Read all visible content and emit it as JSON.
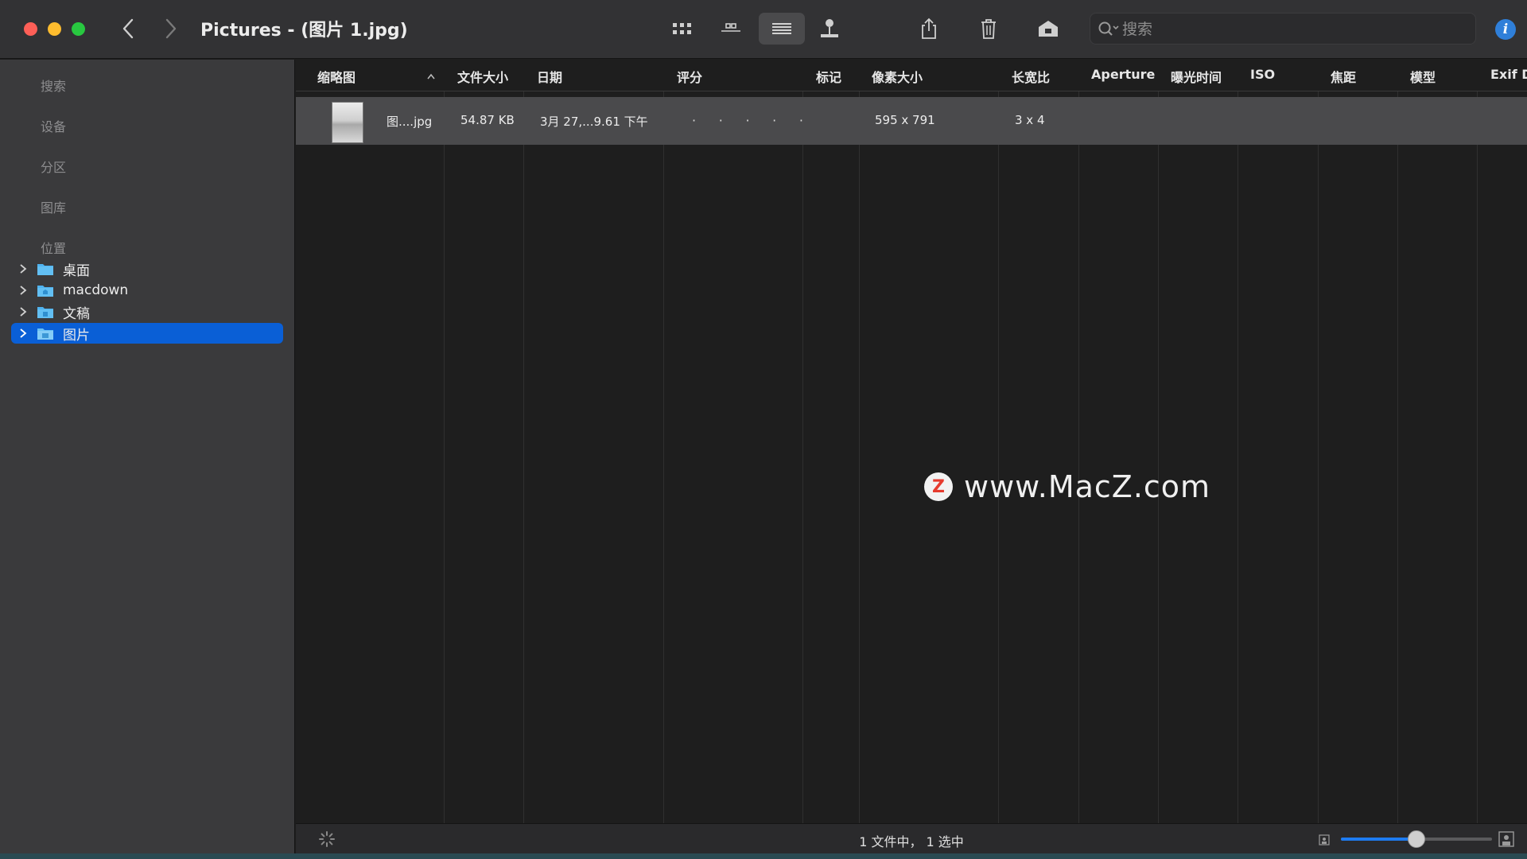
{
  "window": {
    "title": "Pictures - (图片 1.jpg)"
  },
  "toolbar": {
    "icons": [
      "icon-view-icon",
      "gallery-view-icon",
      "list-view-icon",
      "coverflow-view-icon",
      "share-icon",
      "trash-icon",
      "tag-icon"
    ],
    "search_placeholder": "搜索",
    "info_label": "i"
  },
  "sidebar": {
    "sections": [
      "搜索",
      "设备",
      "分区",
      "图库",
      "位置"
    ],
    "locations": [
      {
        "label": "桌面"
      },
      {
        "label": "macdown"
      },
      {
        "label": "文稿"
      },
      {
        "label": "图片",
        "selected": true
      }
    ]
  },
  "table": {
    "columns": [
      "缩略图",
      "文件大小",
      "日期",
      "评分",
      "标记",
      "像素大小",
      "长宽比",
      "Aperture",
      "曝光时间",
      "ISO",
      "焦距",
      "模型",
      "Exif D"
    ],
    "rows": [
      {
        "name": "图....jpg",
        "size": "54.87 KB",
        "date": "3月 27,...9.61 下午",
        "rating": 0,
        "tag": "",
        "pixels": "595 x 791",
        "aspect": "3 x 4"
      }
    ]
  },
  "watermark": {
    "logo": "Z",
    "text": "www.MacZ.com"
  },
  "status": {
    "text": "1 文件中， 1 选中",
    "zoom": 0.5
  },
  "colors": {
    "accent": "#0a5fd6",
    "slider": "#1e7cf2"
  }
}
